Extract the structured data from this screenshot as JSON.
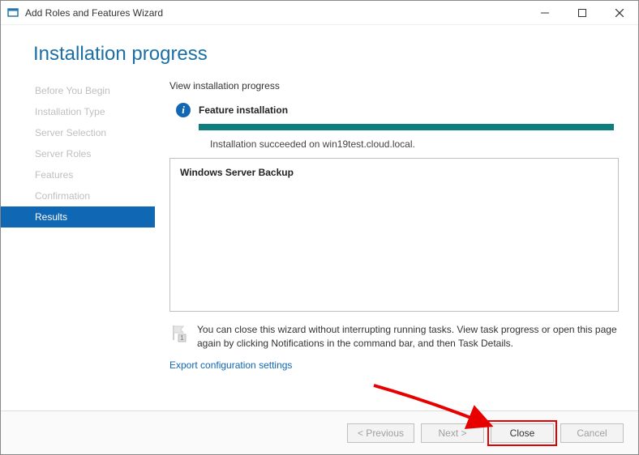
{
  "window": {
    "title": "Add Roles and Features Wizard"
  },
  "header": {
    "page_title": "Installation progress"
  },
  "sidebar": {
    "items": [
      {
        "label": "Before You Begin"
      },
      {
        "label": "Installation Type"
      },
      {
        "label": "Server Selection"
      },
      {
        "label": "Server Roles"
      },
      {
        "label": "Features"
      },
      {
        "label": "Confirmation"
      },
      {
        "label": "Results"
      }
    ]
  },
  "main": {
    "subheading": "View installation progress",
    "status_title": "Feature installation",
    "status_message": "Installation succeeded on win19test.cloud.local.",
    "result_item": "Windows Server Backup",
    "note_text": "You can close this wizard without interrupting running tasks. View task progress or open this page again by clicking Notifications in the command bar, and then Task Details.",
    "export_link": "Export configuration settings"
  },
  "footer": {
    "previous": "< Previous",
    "next": "Next >",
    "close": "Close",
    "cancel": "Cancel"
  }
}
